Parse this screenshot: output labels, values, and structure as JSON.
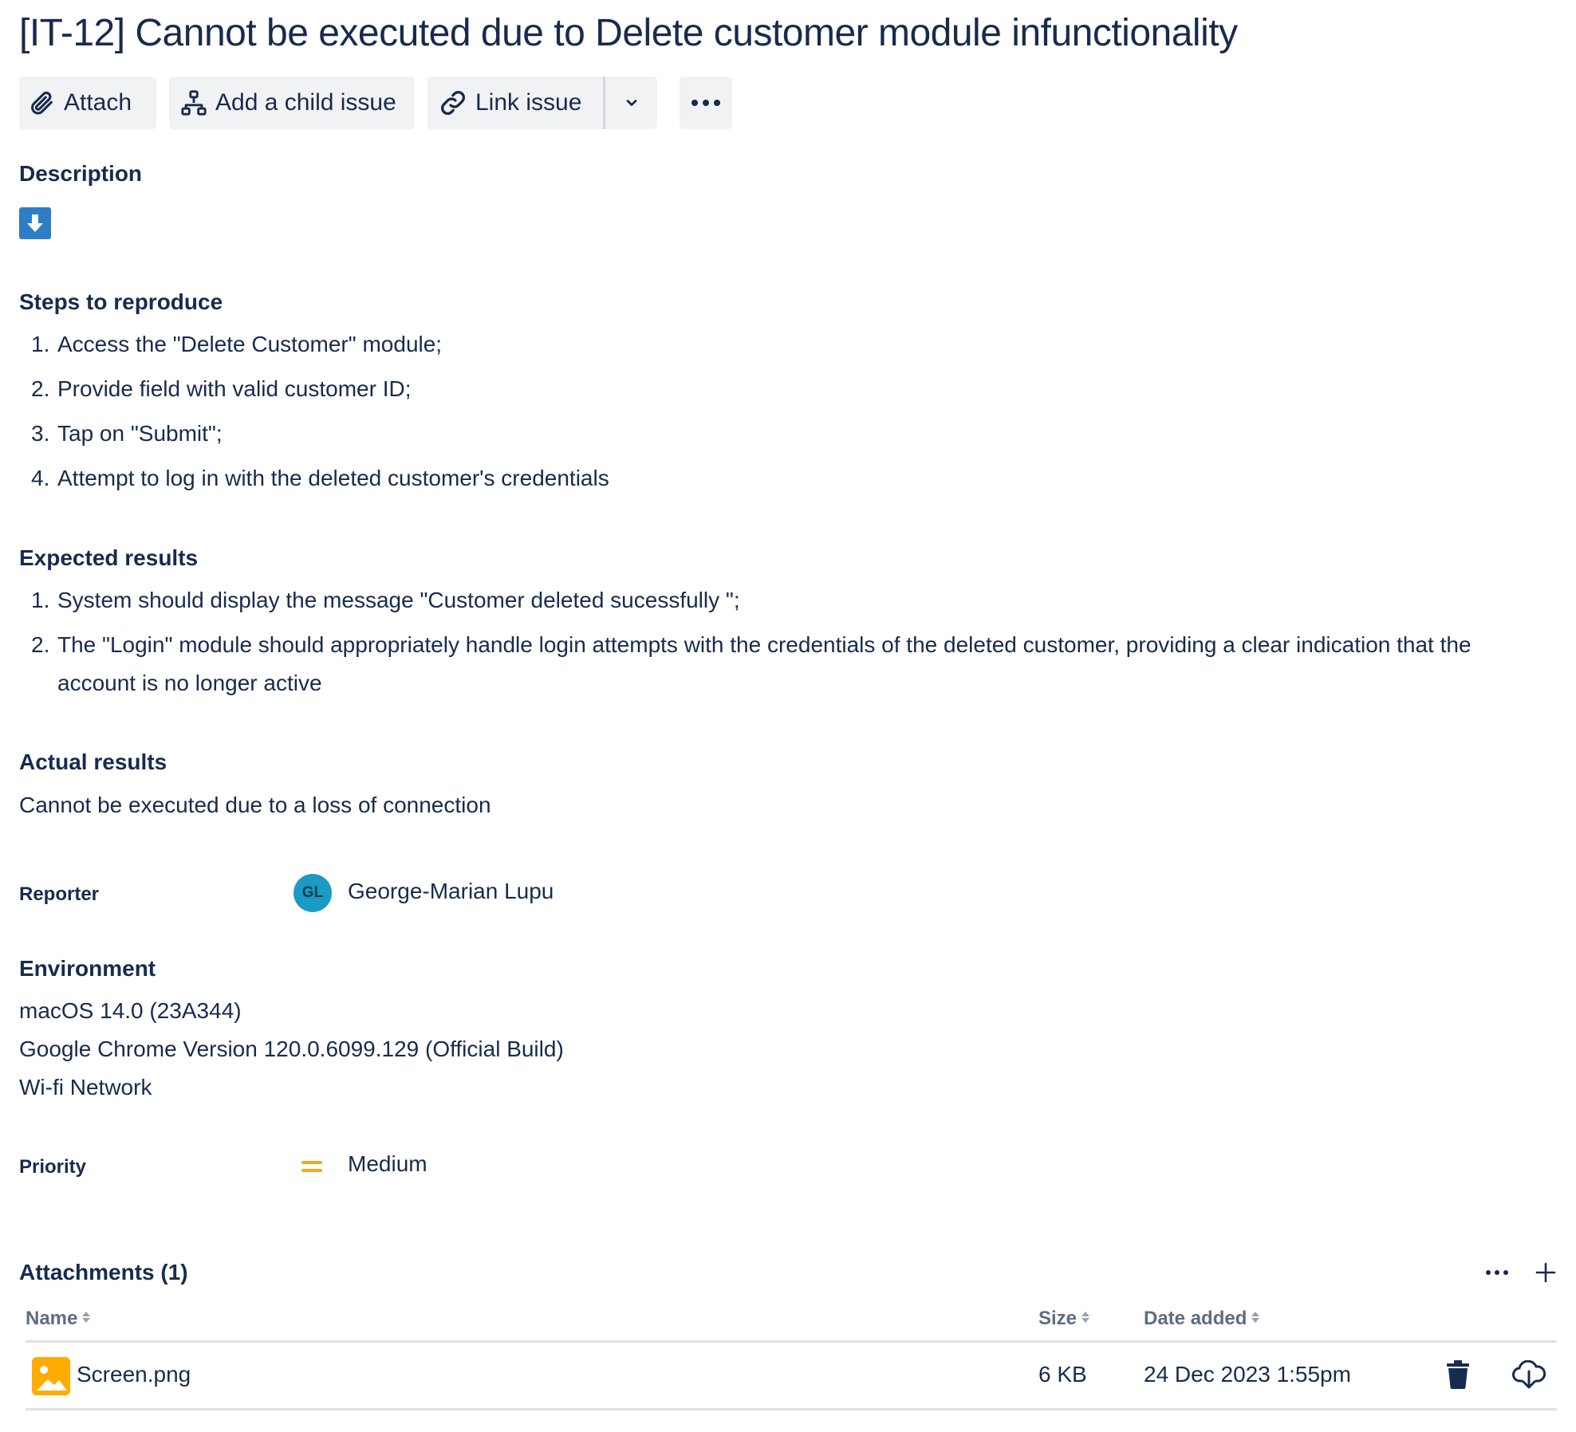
{
  "issue": {
    "title": "[IT-12] Cannot be executed due to Delete customer module infunctionality"
  },
  "toolbar": {
    "attach_label": "Attach",
    "add_child_label": "Add a child issue",
    "link_issue_label": "Link issue"
  },
  "description": {
    "heading": "Description",
    "steps_heading": "Steps to reproduce",
    "steps": [
      {
        "num": "1.",
        "text": "Access the \"Delete Customer\" module;"
      },
      {
        "num": "2.",
        "text": "Provide field with valid customer ID;"
      },
      {
        "num": "3.",
        "text": "Tap on \"Submit\";"
      },
      {
        "num": "4.",
        "text": "Attempt to log in with the deleted customer's credentials"
      }
    ],
    "expected_heading": "Expected results",
    "expected": [
      {
        "num": "1.",
        "text": "System should display the message \"Customer deleted sucessfully \";"
      },
      {
        "num": "2.",
        "text": "The \"Login\" module should appropriately handle login attempts with the credentials of the deleted customer, providing a clear indication that the account is no longer active"
      }
    ],
    "actual_heading": "Actual results",
    "actual_text": "Cannot be executed due to a loss of connection"
  },
  "reporter": {
    "label": "Reporter",
    "initials": "GL",
    "name": "George-Marian Lupu"
  },
  "environment": {
    "heading": "Environment",
    "lines": [
      "macOS 14.0 (23A344)",
      "Google Chrome Version 120.0.6099.129 (Official Build)",
      "Wi-fi Network"
    ]
  },
  "priority": {
    "label": "Priority",
    "value": "Medium",
    "color": "#f5a623"
  },
  "attachments": {
    "title": "Attachments (1)",
    "columns": {
      "name": "Name",
      "size": "Size",
      "date": "Date added"
    },
    "rows": [
      {
        "name": "Screen.png",
        "size": "6 KB",
        "date": "24 Dec 2023 1:55pm"
      }
    ]
  },
  "colors": {
    "text": "#172b4d",
    "button_bg": "#f1f2f4",
    "avatar": "#1b9bc4",
    "download_badge": "#2d7ec4",
    "file_icon": "#ffab00"
  }
}
